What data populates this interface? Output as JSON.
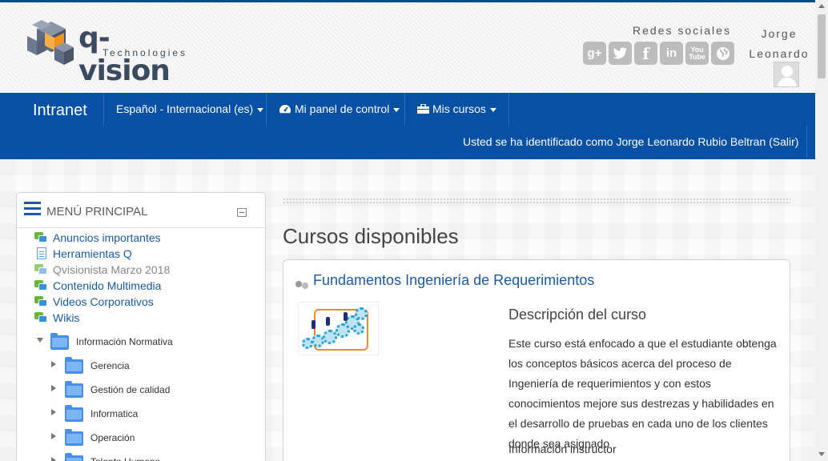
{
  "header": {
    "logo_text": "q-vision",
    "logo_subtext": "Technologies",
    "social_label": "Redes sociales",
    "social_icons": [
      "google-plus-icon",
      "twitter-icon",
      "facebook-icon",
      "linkedin-icon",
      "youtube-icon",
      "web-icon"
    ],
    "user_name": "Jorge Leonardo"
  },
  "navbar": {
    "brand": "Intranet",
    "language": "Español - Internacional (es)",
    "dashboard": "Mi panel de control",
    "courses": "Mis cursos",
    "login_info": "Usted se ha identificado como Jorge Leonardo Rubio Beltran (Salir)"
  },
  "sidebar": {
    "title": "MENÚ PRINCIPAL",
    "items": [
      {
        "label": "Anuncios importantes",
        "icon": "forum-icon"
      },
      {
        "label": "Herramientas Q",
        "icon": "page-icon"
      },
      {
        "label": "Qvisionista Marzo 2018",
        "icon": "forum-icon"
      },
      {
        "label": "Contenido Multimedia",
        "icon": "forum-icon"
      },
      {
        "label": "Videos Corporativos",
        "icon": "forum-icon"
      },
      {
        "label": "Wikis",
        "icon": "forum-icon"
      }
    ],
    "category": "Información Normativa",
    "subcategories": [
      "Gerencia",
      "Gestión de calidad",
      "Informatica",
      "Operación",
      "Talento Humano"
    ]
  },
  "main": {
    "title": "Cursos disponibles",
    "course": {
      "title": "Fundamentos Ingeniería de Requerimientos",
      "description_title": "Descripción del curso",
      "description": "Este curso está enfocado a que el estudiante obtenga los conceptos básicos acerca del proceso de Ingeniería de requerimientos y con estos conocimientos mejore sus destrezas y habilidades en el desarrollo de pruebas en cada uno de los clientes donde sea asignado",
      "instructor_label": "Información instructor"
    }
  },
  "colors": {
    "navbar": "#0651a5",
    "link": "#1b5a9e",
    "brand_border": "#0a4a92"
  }
}
